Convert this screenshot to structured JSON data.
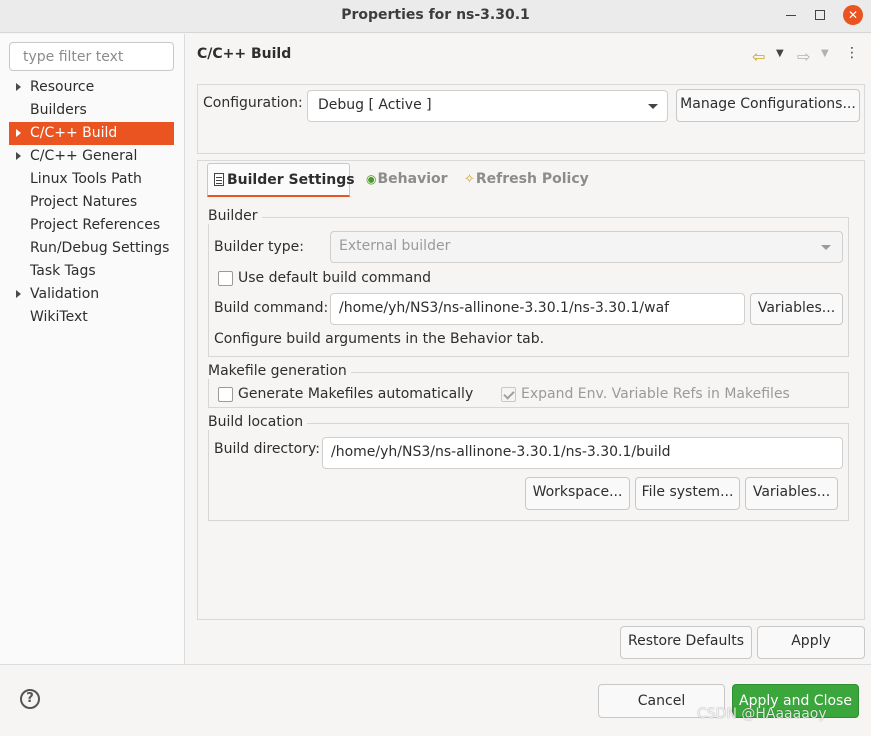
{
  "window": {
    "title": "Properties for ns-3.30.1",
    "minimize_glyph": "",
    "close_glyph": "✕"
  },
  "sidebar": {
    "filter_placeholder": "type filter text",
    "items": [
      {
        "label": "Resource",
        "expandable": true,
        "selected": false
      },
      {
        "label": "Builders",
        "expandable": false,
        "selected": false
      },
      {
        "label": "C/C++ Build",
        "expandable": true,
        "selected": true
      },
      {
        "label": "C/C++ General",
        "expandable": true,
        "selected": false
      },
      {
        "label": "Linux Tools Path",
        "expandable": false,
        "selected": false
      },
      {
        "label": "Project Natures",
        "expandable": false,
        "selected": false
      },
      {
        "label": "Project References",
        "expandable": false,
        "selected": false
      },
      {
        "label": "Run/Debug Settings",
        "expandable": false,
        "selected": false
      },
      {
        "label": "Task Tags",
        "expandable": false,
        "selected": false
      },
      {
        "label": "Validation",
        "expandable": true,
        "selected": false
      },
      {
        "label": "WikiText",
        "expandable": false,
        "selected": false
      }
    ]
  },
  "main": {
    "title": "C/C++ Build",
    "nav": {
      "back_icon": "back-arrow-icon",
      "forward_icon": "forward-arrow-icon",
      "menu_icon": "kebab-menu-icon"
    },
    "configuration": {
      "label": "Configuration:",
      "value": "Debug  [ Active ]",
      "manage_button": "Manage Configurations..."
    },
    "tabs": [
      {
        "label": "Builder Settings",
        "active": true,
        "icon": "document-icon"
      },
      {
        "label": "Behavior",
        "active": false,
        "icon": "behavior-icon"
      },
      {
        "label": "Refresh Policy",
        "active": false,
        "icon": "refresh-icon"
      }
    ],
    "builder": {
      "group_title": "Builder",
      "type_label": "Builder type:",
      "type_value": "External builder",
      "use_default_label": "Use default build command",
      "use_default_checked": false,
      "command_label": "Build command:",
      "command_value": "/home/yh/NS3/ns-allinone-3.30.1/ns-3.30.1/waf",
      "variables_button": "Variables...",
      "hint": "Configure build arguments in the Behavior tab."
    },
    "makefile": {
      "group_title": "Makefile generation",
      "generate_label": "Generate Makefiles automatically",
      "generate_checked": false,
      "expand_label": "Expand Env. Variable Refs in Makefiles",
      "expand_checked": true
    },
    "location": {
      "group_title": "Build location",
      "directory_label": "Build directory:",
      "directory_value": "/home/yh/NS3/ns-allinone-3.30.1/ns-3.30.1/build",
      "workspace_button": "Workspace...",
      "filesystem_button": "File system...",
      "variables_button": "Variables..."
    },
    "restore_defaults_button": "Restore Defaults",
    "apply_button": "Apply"
  },
  "footer": {
    "help_icon": "help-icon",
    "help_glyph": "?",
    "cancel_button": "Cancel",
    "apply_close_button": "Apply and Close",
    "watermark": "CSDN @HAaaaaoy"
  },
  "colors": {
    "accent": "#e95420",
    "primary_button": "#3aa63b"
  }
}
